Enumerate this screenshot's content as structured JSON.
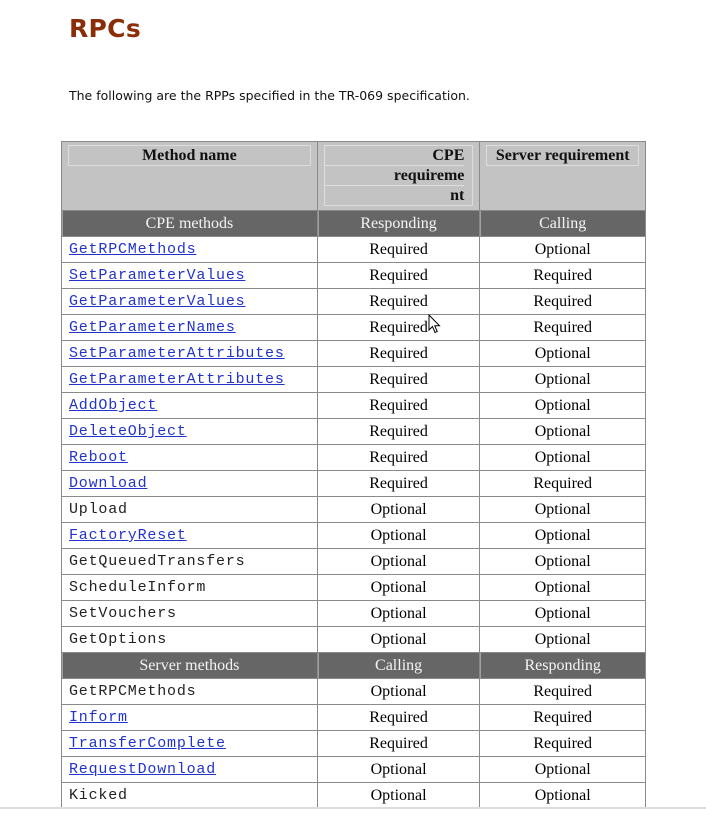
{
  "page": {
    "title": "RPCs",
    "intro": "The following are the RPPs specified in the TR-069 specification.",
    "colors": {
      "title": "#8b2e08",
      "link": "#2233cc",
      "header_bg": "#c3c3c3",
      "group_bg": "#666666"
    }
  },
  "table": {
    "headers": {
      "method": "Method name",
      "cpe_lines": [
        "CPE",
        "requireme",
        "nt"
      ],
      "server": "Server requirement"
    },
    "cpe_group": {
      "label": "CPE methods",
      "cpe_col": "Responding",
      "server_col": "Calling"
    },
    "cpe_rows": [
      {
        "name": "GetRPCMethods",
        "link": true,
        "cpe": "Required",
        "server": "Optional"
      },
      {
        "name": "SetParameterValues",
        "link": true,
        "cpe": "Required",
        "server": "Required"
      },
      {
        "name": "GetParameterValues",
        "link": true,
        "cpe": "Required",
        "server": "Required"
      },
      {
        "name": "GetParameterNames",
        "link": true,
        "cpe": "Required",
        "server": "Required"
      },
      {
        "name": "SetParameterAttributes",
        "link": true,
        "cpe": "Required",
        "server": "Optional"
      },
      {
        "name": "GetParameterAttributes",
        "link": true,
        "cpe": "Required",
        "server": "Optional"
      },
      {
        "name": "AddObject",
        "link": true,
        "cpe": "Required",
        "server": "Optional"
      },
      {
        "name": "DeleteObject",
        "link": true,
        "cpe": "Required",
        "server": "Optional"
      },
      {
        "name": "Reboot",
        "link": true,
        "cpe": "Required",
        "server": "Optional"
      },
      {
        "name": "Download",
        "link": true,
        "cpe": "Required",
        "server": "Required"
      },
      {
        "name": "Upload",
        "link": false,
        "cpe": "Optional",
        "server": "Optional"
      },
      {
        "name": "FactoryReset",
        "link": true,
        "cpe": "Optional",
        "server": "Optional"
      },
      {
        "name": "GetQueuedTransfers",
        "link": false,
        "cpe": "Optional",
        "server": "Optional"
      },
      {
        "name": "ScheduleInform",
        "link": false,
        "cpe": "Optional",
        "server": "Optional"
      },
      {
        "name": "SetVouchers",
        "link": false,
        "cpe": "Optional",
        "server": "Optional"
      },
      {
        "name": "GetOptions",
        "link": false,
        "cpe": "Optional",
        "server": "Optional"
      }
    ],
    "server_group": {
      "label": "Server methods",
      "cpe_col": "Calling",
      "server_col": "Responding"
    },
    "server_rows": [
      {
        "name": "GetRPCMethods",
        "link": false,
        "cpe": "Optional",
        "server": "Required"
      },
      {
        "name": "Inform",
        "link": true,
        "cpe": "Required",
        "server": "Required"
      },
      {
        "name": "TransferComplete",
        "link": true,
        "cpe": "Required",
        "server": "Required"
      },
      {
        "name": "RequestDownload",
        "link": true,
        "cpe": "Optional",
        "server": "Optional"
      },
      {
        "name": "Kicked",
        "link": false,
        "cpe": "Optional",
        "server": "Optional"
      }
    ]
  },
  "cursor": {
    "icon": "mouse-pointer-icon"
  }
}
